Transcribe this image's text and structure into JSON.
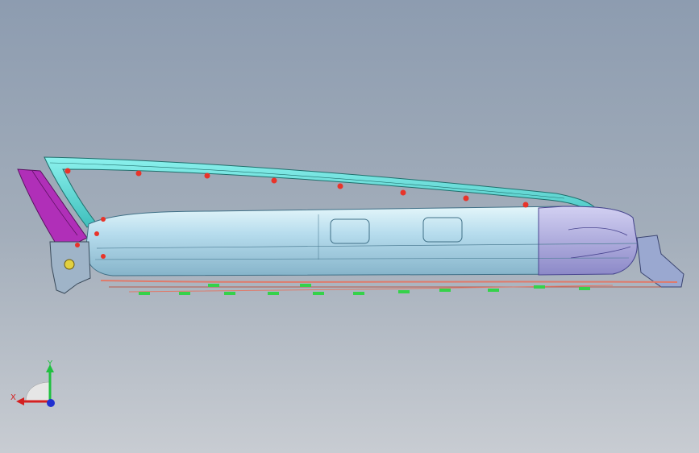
{
  "viewport": {
    "background_top": "#8d9cb0",
    "background_bottom": "#c8ccd2"
  },
  "model": {
    "colors": {
      "rail": "#66e3e0",
      "rail_edge": "#2a8f8c",
      "body_light": "#d8f0f6",
      "body_mid": "#a9d6e6",
      "body_dark": "#7fb0c6",
      "end_cap": "#b9b6e8",
      "bracket": "#b02fb8",
      "harness": "#e07a6a",
      "fixture_red": "#e8342a",
      "fixture_green": "#35d24a"
    }
  },
  "triad": {
    "x_label": "X",
    "y_label": "Y",
    "x_color": "#d42020",
    "y_color": "#20c040",
    "z_color": "#2030d0"
  }
}
